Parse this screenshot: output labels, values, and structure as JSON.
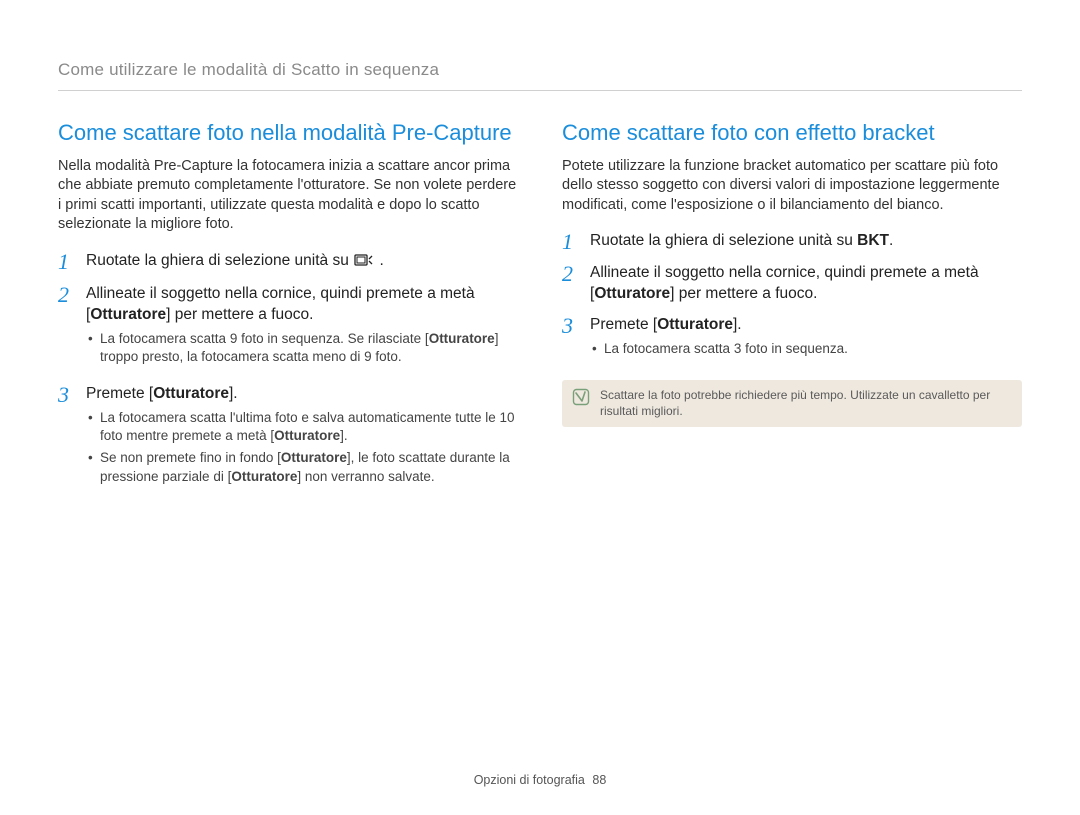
{
  "header": "Come utilizzare le modalità di Scatto in sequenza",
  "left": {
    "title": "Come scattare foto nella modalità Pre-Capture",
    "intro": "Nella modalità Pre-Capture la fotocamera inizia a scattare ancor prima che abbiate premuto completamente l'otturatore. Se non volete perdere i primi scatti importanti, utilizzate questa modalità e dopo lo scatto selezionate la migliore foto.",
    "step1_pre": "Ruotate la ghiera di selezione unità su ",
    "step1_post": ".",
    "step2a": "Allineate il soggetto nella cornice, quindi premete a metà [",
    "step2b": "Otturatore",
    "step2c": "] per mettere a fuoco.",
    "step2_sub_a": "La fotocamera scatta 9 foto in sequenza. Se rilasciate [",
    "step2_sub_b": "Otturatore",
    "step2_sub_c": "] troppo presto, la fotocamera scatta meno di 9 foto.",
    "step3a": "Premete [",
    "step3b": "Otturatore",
    "step3c": "].",
    "step3_sub1_a": "La fotocamera scatta l'ultima foto e salva automaticamente tutte le 10 foto mentre premete a metà [",
    "step3_sub1_b": "Otturatore",
    "step3_sub1_c": "].",
    "step3_sub2_a": "Se non premete fino in fondo [",
    "step3_sub2_b": "Otturatore",
    "step3_sub2_c": "], le foto scattate durante la pressione parziale di [",
    "step3_sub2_d": "Otturatore",
    "step3_sub2_e": "] non verranno salvate."
  },
  "right": {
    "title": "Come scattare foto con effetto bracket",
    "intro": "Potete utilizzare la funzione bracket automatico per scattare più foto dello stesso soggetto con diversi valori di impostazione leggermente modificati, come l'esposizione o il bilanciamento del bianco.",
    "step1a": "Ruotate la ghiera di selezione unità su ",
    "step1b": "BKT",
    "step1c": ".",
    "step2a": "Allineate il soggetto nella cornice, quindi premete a metà [",
    "step2b": "Otturatore",
    "step2c": "] per mettere a fuoco.",
    "step3a": "Premete [",
    "step3b": "Otturatore",
    "step3c": "].",
    "step3_sub": "La fotocamera scatta 3 foto in sequenza.",
    "note": "Scattare la foto potrebbe richiedere più tempo. Utilizzate un cavalletto per risultati migliori."
  },
  "footer": {
    "section": "Opzioni di fotografia",
    "page": "88"
  }
}
